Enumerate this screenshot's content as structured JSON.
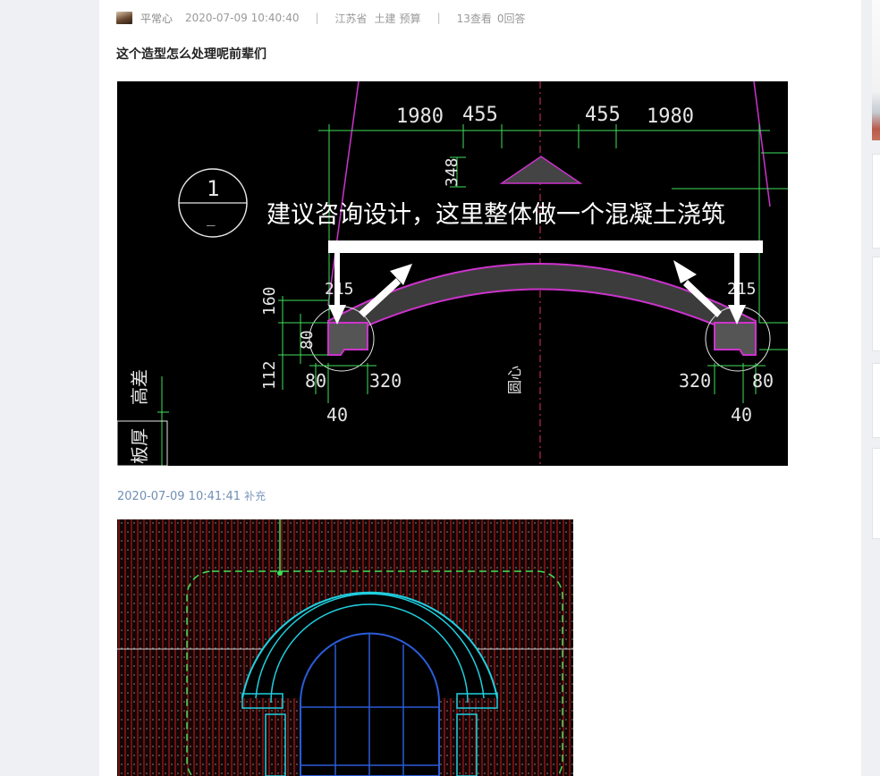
{
  "post": {
    "author": "平常心",
    "time": "2020-07-09 10:40:40",
    "separator": "|",
    "region": "江苏省",
    "tag1": "土建",
    "tag2": "预算",
    "views": "13查看",
    "answers": "0回答",
    "title": "这个造型怎么处理呢前辈们"
  },
  "image1": {
    "dims_top": [
      "1980",
      "455",
      "455",
      "1980"
    ],
    "dim_348": "348",
    "circle_label": "1",
    "circle_sub": "_",
    "annotation": "建议咨询设计，这里整体做一个混凝土浇筑",
    "dim_215_left": "215",
    "dim_215_right": "215",
    "dim_160": "160",
    "dim_80_left_vert": "80",
    "dim_112": "112",
    "dim_80_left": "80",
    "dim_320_left": "320",
    "dim_320_right": "320",
    "dim_80_right": "80",
    "dim_40_left": "40",
    "dim_40_right": "40",
    "label_center": "圆心",
    "label_height": "高差",
    "label_slab": "板厚"
  },
  "supplement": {
    "time": "2020-07-09 10:41:41",
    "label": "补充"
  },
  "colors": {
    "cad_bg": "#000000",
    "green": "#3fe05a",
    "magenta": "#cc33cc",
    "cyan": "#20d0e0",
    "link": "#6f8fb7"
  }
}
